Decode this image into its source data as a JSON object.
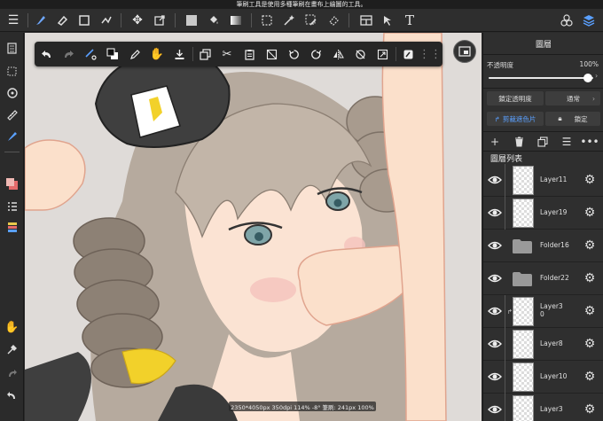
{
  "statusbar": {
    "text": "筆刷工具是使用多種筆刷在畫布上繪圖的工具。"
  },
  "topbar": {
    "icons": [
      "menu-icon",
      "brush-icon",
      "eraser-icon",
      "rect-icon",
      "shape-icon",
      "move-icon",
      "transform-icon",
      "fill-color-icon",
      "bucket-icon",
      "gradient-icon",
      "select-icon",
      "magic-wand-icon",
      "select-pen-icon",
      "select-eraser-icon",
      "frame-icon",
      "text-icon",
      "materials-icon",
      "layers-icon"
    ]
  },
  "floatbar": {
    "icons": [
      "undo-icon",
      "redo-icon",
      "snap-icon",
      "color-swap-icon",
      "pen-icon",
      "hand-icon",
      "import-icon",
      "copy-icon",
      "cut-icon",
      "paste-icon",
      "clear-icon",
      "rotate-left-icon",
      "rotate-right-icon",
      "flip-icon",
      "reset-rotation-icon",
      "fit-icon",
      "filter-icon",
      "more-icon"
    ]
  },
  "canvas": {
    "status": "2350*4050px 350dpi 114% -8° 筆刷: 241px 100%"
  },
  "panel": {
    "title": "圖層",
    "opacity_label": "不透明度",
    "opacity_value": "100%",
    "opacity": 1.0,
    "lock_alpha_label": "鎖定透明度",
    "blend_mode_label": "通常",
    "clipping_label": "剪裁遮色片",
    "lock_label": "鎖定",
    "list_title": "圖層列表",
    "layers": [
      {
        "name": "Layer11",
        "type": "layer"
      },
      {
        "name": "Layer19",
        "type": "layer"
      },
      {
        "name": "Folder16",
        "type": "folder"
      },
      {
        "name": "Folder22",
        "type": "folder"
      },
      {
        "name": "Layer3\n0",
        "type": "layer",
        "clipped": true
      },
      {
        "name": "Layer8",
        "type": "layer"
      },
      {
        "name": "Layer10",
        "type": "layer"
      },
      {
        "name": "Layer3",
        "type": "layer"
      }
    ]
  },
  "colors": {
    "accent": "#5aa0ff",
    "panel_bg": "#2f2f2f",
    "toolbar_bg": "#2e2e2e",
    "primary_color": "#f0b9b4"
  }
}
